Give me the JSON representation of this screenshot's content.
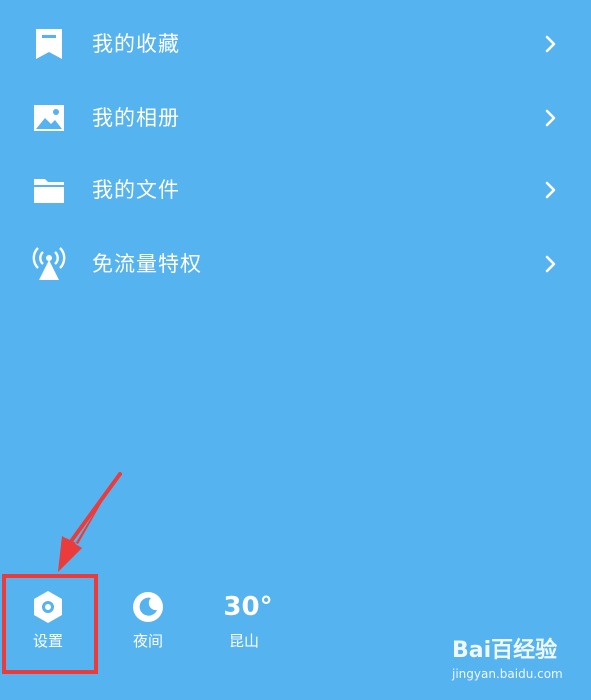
{
  "menu": {
    "items": [
      {
        "label": "我的收藏",
        "icon": "bookmark-icon"
      },
      {
        "label": "我的相册",
        "icon": "image-icon"
      },
      {
        "label": "我的文件",
        "icon": "folder-icon"
      },
      {
        "label": "免流量特权",
        "icon": "signal-tower-icon"
      }
    ]
  },
  "bottom_bar": {
    "settings_label": "设置",
    "night_label": "夜间",
    "weather_temp": "30°",
    "weather_city": "昆山"
  },
  "watermark": {
    "brand": "Bai百经验",
    "url": "jingyan.baidu.com"
  },
  "colors": {
    "background": "#55b3ef",
    "highlight": "#ec3b3b",
    "foreground": "#ffffff"
  }
}
